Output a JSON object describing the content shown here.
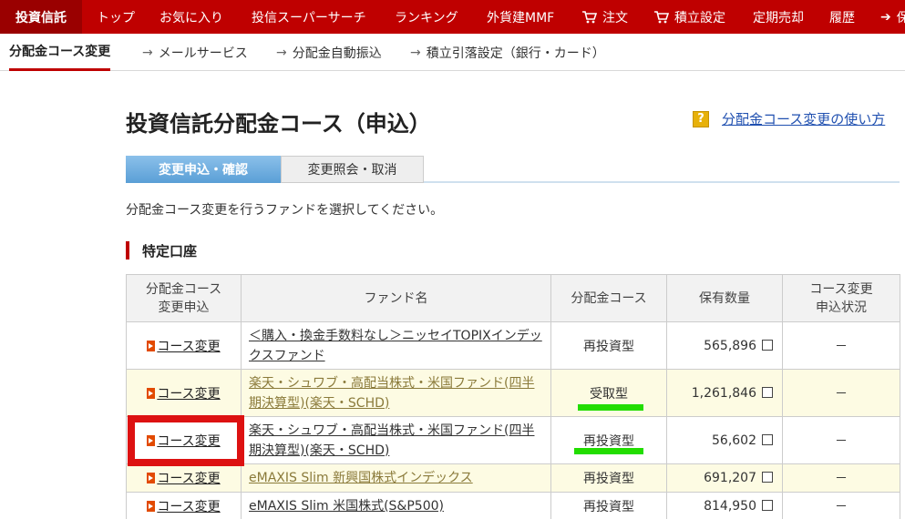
{
  "topnav": {
    "brand": "投資信託",
    "items": [
      "トップ",
      "お気に入り",
      "投信スーパーサーチ",
      "ランキング",
      "外貨建MMF",
      "注文",
      "積立設定",
      "定期売却",
      "履歴",
      "保"
    ]
  },
  "subnav": {
    "active": "分配金コース変更",
    "items": [
      "メールサービス",
      "分配金自動振込",
      "積立引落設定（銀行・カード）"
    ]
  },
  "page": {
    "title": "投資信託分配金コース（申込）",
    "help_link": "分配金コース変更の使い方",
    "help_icon": "?"
  },
  "tabs": {
    "active": "変更申込・確認",
    "inactive": "変更照会・取消"
  },
  "instruction": "分配金コース変更を行うファンドを選択してください。",
  "section_title": "特定口座",
  "table": {
    "headers": [
      "分配金コース\n変更申込",
      "ファンド名",
      "分配金コース",
      "保有数量",
      "コース変更\n申込状況"
    ],
    "rows": [
      {
        "action": "コース変更",
        "fund": "＜購入・換金手数料なし＞ニッセイTOPIXインデックスファンド",
        "course": "再投資型",
        "qty": "565,896",
        "status": "－"
      },
      {
        "action": "コース変更",
        "fund": "楽天・シュワブ・高配当株式・米国ファンド(四半期決算型)(楽天・SCHD)",
        "course": "受取型",
        "qty": "1,261,846",
        "status": "－"
      },
      {
        "action": "コース変更",
        "fund": "楽天・シュワブ・高配当株式・米国ファンド(四半期決算型)(楽天・SCHD)",
        "course": "再投資型",
        "qty": "56,602",
        "status": "－"
      },
      {
        "action": "コース変更",
        "fund": "eMAXIS Slim 新興国株式インデックス",
        "course": "再投資型",
        "qty": "691,207",
        "status": "－"
      },
      {
        "action": "コース変更",
        "fund": "eMAXIS Slim 米国株式(S&P500)",
        "course": "再投資型",
        "qty": "814,950",
        "status": "－"
      }
    ]
  },
  "colors": {
    "brand_red": "#bf0000",
    "tab_blue": "#5a9fd6",
    "highlight_green": "#22dd00",
    "annotation_red": "#dd1111"
  }
}
